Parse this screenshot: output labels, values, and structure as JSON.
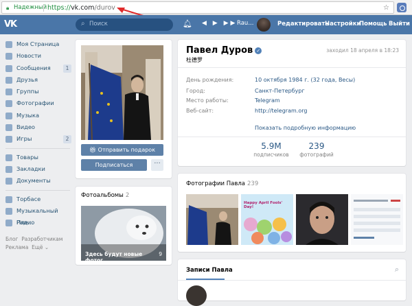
{
  "browser": {
    "secure_label": "Надежный",
    "url_prefix": "https://",
    "url_host": "vk.com",
    "url_path": "/durov"
  },
  "topbar": {
    "logo": "VK",
    "search_placeholder": "Поиск",
    "track": "Rau...",
    "nav": [
      "Редактировать",
      "Настройки",
      "Помощь",
      "Выйти"
    ]
  },
  "sidebar": {
    "items": [
      {
        "label": "Моя Страница",
        "count": ""
      },
      {
        "label": "Новости",
        "count": ""
      },
      {
        "label": "Сообщения",
        "count": "1"
      },
      {
        "label": "Друзья",
        "count": ""
      },
      {
        "label": "Группы",
        "count": ""
      },
      {
        "label": "Фотографии",
        "count": ""
      },
      {
        "label": "Музыка",
        "count": ""
      },
      {
        "label": "Видео",
        "count": ""
      },
      {
        "label": "Игры",
        "count": "2"
      }
    ],
    "items2": [
      "Товары",
      "Закладки",
      "Документы"
    ],
    "items3": [
      "Торбасе",
      "Музыкальный Пле...",
      "Радио"
    ],
    "footer": [
      "Блог",
      "Разработчикам",
      "Реклама",
      "Ещё ⌄"
    ]
  },
  "profile": {
    "gift_button": "Отправить подарок",
    "subscribe_button": "Подписаться",
    "more_button": "···",
    "albums_title": "Фотоальбомы",
    "albums_count": "2",
    "album_caption": "Здесь будут новые фотог...",
    "album_count": "9"
  },
  "info": {
    "name": "Павел Дуров",
    "native_name": "杜德罗",
    "last_seen": "заходил 18 апреля в 18:23",
    "rows": [
      {
        "label": "День рождения:",
        "value": "10 октября 1984 г. (32 года, Весы)"
      },
      {
        "label": "Город:",
        "value": "Санкт-Петербург"
      },
      {
        "label": "Место работы:",
        "value": "Telegram"
      },
      {
        "label": "Веб-сайт:",
        "value": "http://telegram.org"
      }
    ],
    "show_more": "Показать подробную информацию",
    "stats": [
      {
        "value": "5.9M",
        "label": "подписчиков"
      },
      {
        "value": "239",
        "label": "фотографий"
      }
    ]
  },
  "photos": {
    "title": "Фотографии Павла",
    "count": "239",
    "thumb2_text": "Happy April Fools' Day!"
  },
  "posts": {
    "title": "Записи Павла"
  }
}
